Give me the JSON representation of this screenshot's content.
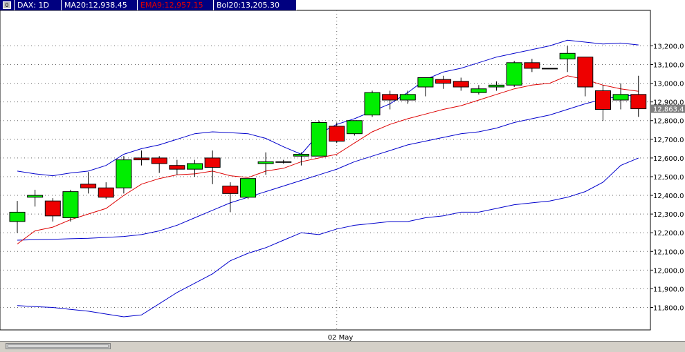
{
  "legend": {
    "icon_label": "0",
    "items": [
      {
        "label": "DAX: 1D",
        "color": "#ffffff",
        "bg": "#000080"
      },
      {
        "label": "MA20:12,938.45",
        "color": "#ffffff",
        "bg": "#000080"
      },
      {
        "label": "EMA9:12,957.15",
        "color": "#e00000",
        "bg": "#000080"
      },
      {
        "label": "Bol20:13,205.30",
        "color": "#ffffff",
        "bg": "#000080"
      }
    ]
  },
  "colors": {
    "up": "#00ee00",
    "down": "#ee0000",
    "ma": "#0000cc",
    "ema": "#dd0000",
    "boll": "#0000cc",
    "grid": "#606060",
    "axis": "#000000"
  },
  "chart_data": {
    "type": "candlestick",
    "instrument": "DAX",
    "timeframe": "1D",
    "x_marker_label": "02 May",
    "x_marker_index": 18,
    "yticks": [
      11800,
      11900,
      12000,
      12100,
      12200,
      12300,
      12400,
      12500,
      12600,
      12700,
      12800,
      12900,
      13000,
      13100,
      13200
    ],
    "ylim": [
      11680,
      13390
    ],
    "last_price": 12863.4,
    "last_price_label": "12,863.4",
    "grid": true,
    "candles": [
      {
        "o": 12260,
        "h": 12370,
        "l": 12200,
        "c": 12310
      },
      {
        "o": 12390,
        "h": 12430,
        "l": 12340,
        "c": 12400
      },
      {
        "o": 12370,
        "h": 12385,
        "l": 12260,
        "c": 12290
      },
      {
        "o": 12280,
        "h": 12430,
        "l": 12260,
        "c": 12420
      },
      {
        "o": 12460,
        "h": 12525,
        "l": 12410,
        "c": 12440
      },
      {
        "o": 12440,
        "h": 12470,
        "l": 12380,
        "c": 12390
      },
      {
        "o": 12440,
        "h": 12610,
        "l": 12410,
        "c": 12590
      },
      {
        "o": 12600,
        "h": 12640,
        "l": 12560,
        "c": 12590
      },
      {
        "o": 12600,
        "h": 12610,
        "l": 12520,
        "c": 12570
      },
      {
        "o": 12560,
        "h": 12590,
        "l": 12510,
        "c": 12540
      },
      {
        "o": 12540,
        "h": 12590,
        "l": 12500,
        "c": 12570
      },
      {
        "o": 12600,
        "h": 12640,
        "l": 12460,
        "c": 12550
      },
      {
        "o": 12450,
        "h": 12470,
        "l": 12310,
        "c": 12410
      },
      {
        "o": 12390,
        "h": 12480,
        "l": 12380,
        "c": 12490
      },
      {
        "o": 12570,
        "h": 12630,
        "l": 12510,
        "c": 12580
      },
      {
        "o": 12580,
        "h": 12590,
        "l": 12570,
        "c": 12580
      },
      {
        "o": 12610,
        "h": 12630,
        "l": 12560,
        "c": 12620
      },
      {
        "o": 12610,
        "h": 12800,
        "l": 12610,
        "c": 12790
      },
      {
        "o": 12770,
        "h": 12790,
        "l": 12680,
        "c": 12690
      },
      {
        "o": 12730,
        "h": 12790,
        "l": 12720,
        "c": 12800
      },
      {
        "o": 12830,
        "h": 12960,
        "l": 12820,
        "c": 12950
      },
      {
        "o": 12940,
        "h": 12960,
        "l": 12860,
        "c": 12910
      },
      {
        "o": 12910,
        "h": 12960,
        "l": 12890,
        "c": 12940
      },
      {
        "o": 12980,
        "h": 13030,
        "l": 12930,
        "c": 13030
      },
      {
        "o": 13020,
        "h": 13040,
        "l": 12970,
        "c": 13000
      },
      {
        "o": 13010,
        "h": 13030,
        "l": 12960,
        "c": 12980
      },
      {
        "o": 12950,
        "h": 12990,
        "l": 12940,
        "c": 12970
      },
      {
        "o": 12980,
        "h": 13010,
        "l": 12960,
        "c": 12990
      },
      {
        "o": 12990,
        "h": 13120,
        "l": 12980,
        "c": 13110
      },
      {
        "o": 13110,
        "h": 13130,
        "l": 13060,
        "c": 13080
      },
      {
        "o": 13080,
        "h": 13080,
        "l": 13080,
        "c": 13080
      },
      {
        "o": 13130,
        "h": 13200,
        "l": 13060,
        "c": 13160
      },
      {
        "o": 13140,
        "h": 13140,
        "l": 12930,
        "c": 12980
      },
      {
        "o": 12960,
        "h": 12990,
        "l": 12800,
        "c": 12860
      },
      {
        "o": 12910,
        "h": 13000,
        "l": 12860,
        "c": 12940
      },
      {
        "o": 12940,
        "h": 13040,
        "l": 12820,
        "c": 12863.4
      }
    ],
    "series": [
      {
        "name": "MA20",
        "values": [
          12160,
          12163,
          12165,
          12168,
          12170,
          12175,
          12180,
          12190,
          12210,
          12240,
          12280,
          12320,
          12360,
          12390,
          12420,
          12450,
          12480,
          12510,
          12540,
          12580,
          12610,
          12640,
          12670,
          12690,
          12710,
          12730,
          12740,
          12760,
          12790,
          12810,
          12830,
          12860,
          12890,
          12915,
          12930,
          12938
        ]
      },
      {
        "name": "EMA9",
        "values": [
          12140,
          12210,
          12230,
          12270,
          12300,
          12330,
          12400,
          12460,
          12490,
          12510,
          12515,
          12530,
          12505,
          12495,
          12530,
          12545,
          12580,
          12600,
          12620,
          12680,
          12740,
          12780,
          12810,
          12835,
          12860,
          12880,
          12910,
          12940,
          12970,
          12990,
          13000,
          13040,
          13020,
          12990,
          12970,
          12957
        ]
      },
      {
        "name": "BolUpper",
        "values": [
          12530,
          12515,
          12505,
          12520,
          12530,
          12560,
          12620,
          12650,
          12670,
          12700,
          12730,
          12740,
          12735,
          12730,
          12705,
          12660,
          12620,
          12730,
          12780,
          12810,
          12850,
          12890,
          12950,
          13020,
          13060,
          13080,
          13110,
          13140,
          13160,
          13180,
          13200,
          13230,
          13220,
          13210,
          13215,
          13205
        ]
      },
      {
        "name": "BolLower",
        "values": [
          11810,
          11805,
          11800,
          11790,
          11780,
          11765,
          11750,
          11760,
          11820,
          11880,
          11930,
          11980,
          12050,
          12090,
          12120,
          12160,
          12200,
          12190,
          12220,
          12240,
          12250,
          12260,
          12260,
          12280,
          12290,
          12310,
          12310,
          12330,
          12350,
          12360,
          12370,
          12390,
          12420,
          12470,
          12560,
          12600
        ]
      }
    ]
  }
}
